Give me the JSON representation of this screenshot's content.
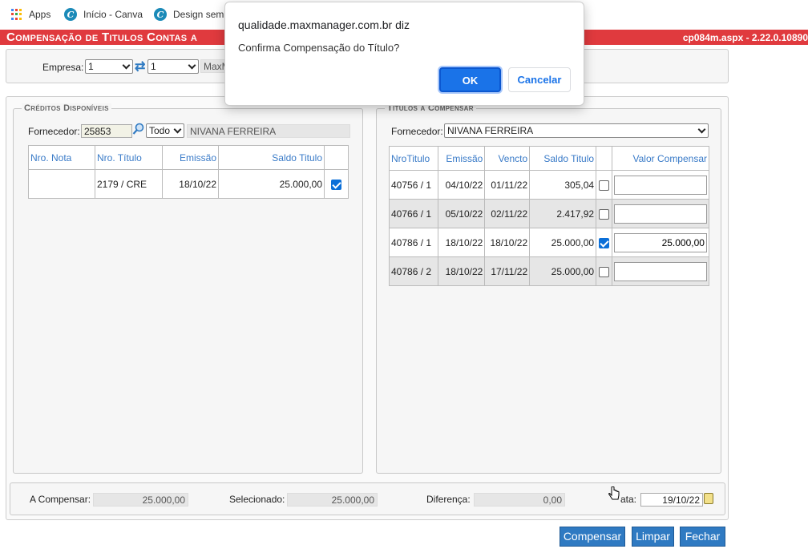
{
  "bookmarks": [
    {
      "label": "Apps",
      "icon": "apps-grid-icon"
    },
    {
      "label": "Início - Canva",
      "icon": "canva-icon"
    },
    {
      "label": "Design sem",
      "icon": "canva-icon"
    }
  ],
  "header": {
    "title": "Compensação de Titulos Contas a",
    "version": "cp084m.aspx - 2.22.0.10890"
  },
  "empresa": {
    "label": "Empresa:",
    "select1": "1",
    "select2": "1",
    "name_partial": "MaxM"
  },
  "creditos": {
    "legend": "Créditos Disponíveis",
    "fornecedor_label": "Fornecedor:",
    "fornecedor_code": "25853",
    "filter": "Todo",
    "fornecedor_name": "NIVANA FERREIRA",
    "columns": [
      "Nro. Nota",
      "Nro. Título",
      "Emissão",
      "Saldo Titulo",
      ""
    ],
    "rows": [
      {
        "nota": "",
        "titulo": "2179 / CRE",
        "emissao": "18/10/22",
        "saldo": "25.000,00",
        "checked": true
      }
    ]
  },
  "titulos": {
    "legend": "Titulos à Compensar",
    "fornecedor_label": "Fornecedor:",
    "fornecedor_select": "NIVANA FERREIRA",
    "columns": [
      "NroTitulo",
      "Emissão",
      "Vencto",
      "Saldo Titulo",
      "",
      "Valor Compensar"
    ],
    "rows": [
      {
        "titulo": "40756 / 1",
        "emissao": "04/10/22",
        "vencto": "01/11/22",
        "saldo": "305,04",
        "checked": false,
        "valor": ""
      },
      {
        "titulo": "40766 / 1",
        "emissao": "05/10/22",
        "vencto": "02/11/22",
        "saldo": "2.417,92",
        "checked": false,
        "valor": ""
      },
      {
        "titulo": "40786 / 1",
        "emissao": "18/10/22",
        "vencto": "18/10/22",
        "saldo": "25.000,00",
        "checked": true,
        "valor": "25.000,00"
      },
      {
        "titulo": "40786 / 2",
        "emissao": "18/10/22",
        "vencto": "17/11/22",
        "saldo": "25.000,00",
        "checked": false,
        "valor": ""
      }
    ]
  },
  "totals": {
    "a_compensar_label": "A Compensar:",
    "a_compensar": "25.000,00",
    "selecionado_label": "Selecionado:",
    "selecionado": "25.000,00",
    "diferenca_label": "Diferença:",
    "diferenca": "0,00",
    "data_label": "ata:",
    "data": "19/10/22"
  },
  "buttons": {
    "compensar": "Compensar",
    "limpar": "Limpar",
    "fechar": "Fechar"
  },
  "dialog": {
    "host": "qualidade.maxmanager.com.br diz",
    "message": "Confirma Compensação do Título?",
    "ok": "OK",
    "cancel": "Cancelar"
  }
}
